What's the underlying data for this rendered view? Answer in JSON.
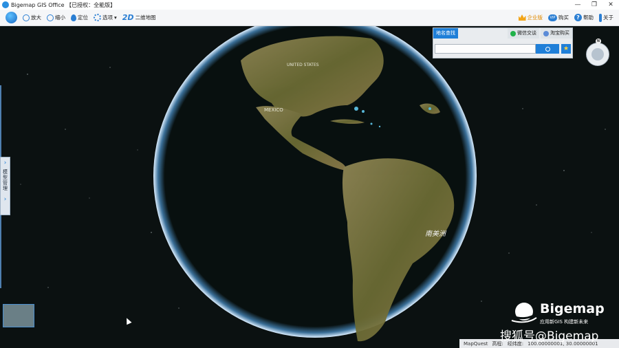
{
  "titlebar": {
    "title": "Bigemap GIS Office 【已授权：全能版】",
    "min": "—",
    "max": "❐",
    "close": "✕"
  },
  "toolbar": {
    "zoom_in": "放大",
    "zoom_out": "缩小",
    "locate": "定位",
    "options": "选项",
    "options_arrow": "▾",
    "twod_icon": "2D",
    "twod": "二维地图",
    "enterprise": "企业版",
    "buy_icon": "VIP",
    "buy": "购买",
    "help_icon": "?",
    "help": "帮助",
    "about": "关于"
  },
  "place_search": {
    "tab_active": "地名查找",
    "tab_wechat": "微信交谈",
    "tab_taobao": "淘宝购买",
    "input_value": "",
    "star": "★"
  },
  "compass": {
    "north": "N"
  },
  "side_panel": {
    "label": "模型管理",
    "chev_top": "›",
    "chev_bottom": "›"
  },
  "map_labels": {
    "usa": "UNITED STATES",
    "mexico": "MEXICO",
    "south_america": "南美洲"
  },
  "watermark": {
    "brand": "Bigemap",
    "slogan": "应用新GIS  构建新未来",
    "credit": "搜狐号@Bigemap"
  },
  "status": {
    "provider": "MapQuest",
    "elevation_label": "高程:",
    "coords_label": "经纬度:",
    "coords": "100.00000001, 30.00000001"
  },
  "colors": {
    "space": "#0b1111",
    "ocean": "#07100f",
    "land": "#6e6a3a",
    "accent": "#1f7fd8"
  }
}
